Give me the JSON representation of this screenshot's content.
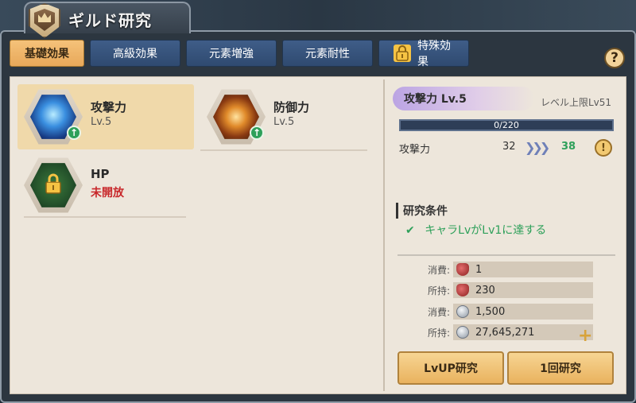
{
  "header": {
    "title": "ギルド研究"
  },
  "tabs": [
    {
      "label": "基礎効果",
      "active": true,
      "locked": false
    },
    {
      "label": "高級効果",
      "active": false,
      "locked": false
    },
    {
      "label": "元素増強",
      "active": false,
      "locked": false
    },
    {
      "label": "元素耐性",
      "active": false,
      "locked": false
    },
    {
      "label": "特殊効果",
      "active": false,
      "locked": true
    }
  ],
  "help_label": "?",
  "skills": [
    {
      "name": "攻撃力",
      "level": "Lv.5",
      "selected": true,
      "upgradeable": true,
      "icon": "sword-cube-icon"
    },
    {
      "name": "防御力",
      "level": "Lv.5",
      "selected": false,
      "upgradeable": true,
      "icon": "claw-shield-icon"
    },
    {
      "name": "HP",
      "status": "未開放",
      "selected": false,
      "locked": true,
      "icon": "lock-icon"
    }
  ],
  "detail": {
    "title": "攻撃力 Lv.5",
    "level_cap": "レベル上限Lv51",
    "progress_text": "0/220",
    "progress": 0,
    "stat": {
      "label": "攻撃力",
      "from": "32",
      "to": "38",
      "arrows": "❯❯❯"
    },
    "warning": "!"
  },
  "conditions": {
    "title": "研究条件",
    "items": [
      {
        "text": "キャラLvがLv1に達する",
        "met": true
      }
    ]
  },
  "resources": [
    {
      "label": "消費:",
      "icon": "heart-token-icon",
      "value": "1"
    },
    {
      "label": "所持:",
      "icon": "heart-token-icon",
      "value": "230"
    },
    {
      "label": "消費:",
      "icon": "silver-coin-icon",
      "value": "1,500"
    },
    {
      "label": "所持:",
      "icon": "silver-coin-icon",
      "value": "27,645,271"
    }
  ],
  "plus_label": "+",
  "buttons": {
    "lvup": "LvUP研究",
    "once": "1回研究"
  },
  "colors": {
    "accent": "#e8a85a",
    "tab_blue": "#2f4a70",
    "green": "#2ea05a",
    "red": "#c8282b"
  }
}
